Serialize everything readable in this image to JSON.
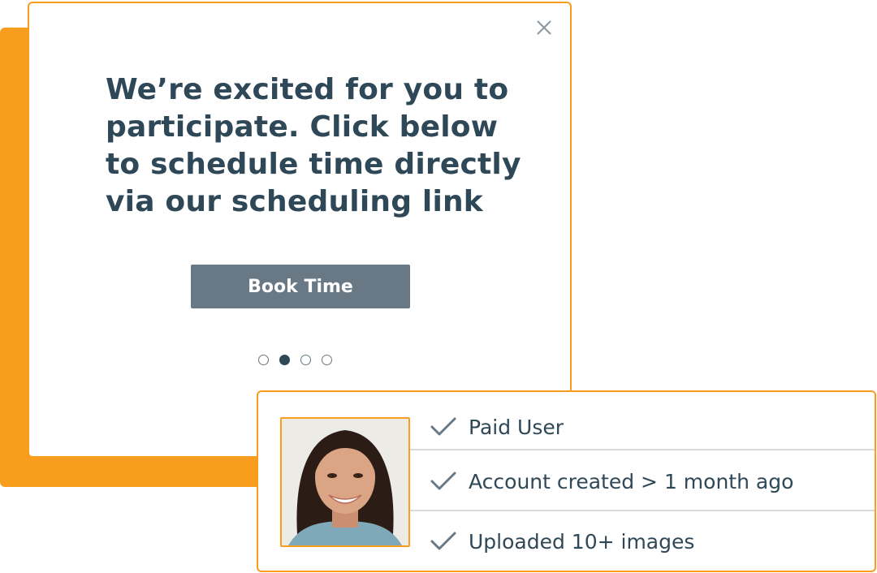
{
  "modal": {
    "headline": "We’re excited for you to participate. Click below to schedule time directly via our scheduling link",
    "button_label": "Book Time",
    "close_icon": "close-icon",
    "carousel": {
      "count": 4,
      "active_index": 1
    }
  },
  "criteria": {
    "items": [
      {
        "icon": "checkmark-icon",
        "label": "Paid User"
      },
      {
        "icon": "checkmark-icon",
        "label": "Account created > 1 month ago"
      },
      {
        "icon": "checkmark-icon",
        "label": "Uploaded 10+ images"
      }
    ]
  },
  "colors": {
    "accent": "#f99d1f",
    "text": "#2f4858",
    "button": "#687884"
  }
}
